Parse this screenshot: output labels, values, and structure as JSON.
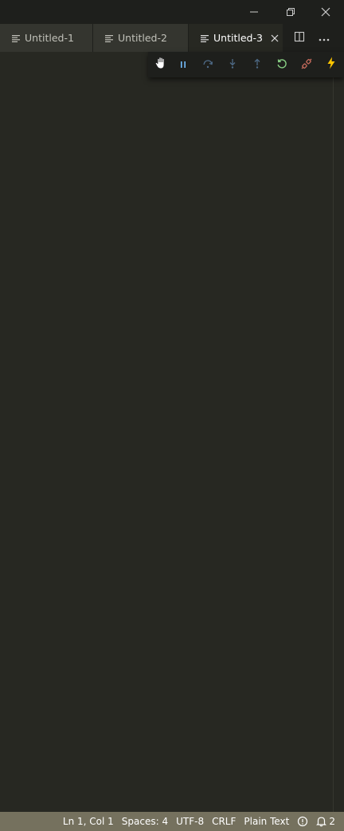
{
  "window": {
    "controls": {
      "minimize_icon": "minimize-icon",
      "restore_icon": "restore-icon",
      "close_icon": "close-icon"
    }
  },
  "tabs": [
    {
      "label": "Untitled-1",
      "icon": "text-file-icon",
      "active": false
    },
    {
      "label": "Untitled-2",
      "icon": "text-file-icon",
      "active": false
    },
    {
      "label": "Untitled-3",
      "icon": "text-file-icon",
      "active": true,
      "closable": true
    }
  ],
  "tab_actions": [
    {
      "icon": "split-editor-icon"
    },
    {
      "icon": "more-actions-icon"
    }
  ],
  "debug_toolbar": {
    "buttons": [
      {
        "icon": "drag-grip-icon",
        "color": "#ffffff"
      },
      {
        "icon": "pause-icon",
        "color": "#75beff"
      },
      {
        "icon": "step-over-icon",
        "color": "#75beff"
      },
      {
        "icon": "step-into-icon",
        "color": "#75beff"
      },
      {
        "icon": "step-out-icon",
        "color": "#75beff"
      },
      {
        "icon": "restart-icon",
        "color": "#89d185"
      },
      {
        "icon": "disconnect-icon",
        "color": "#f48771"
      },
      {
        "icon": "hot-reload-icon",
        "color": "#ffc600"
      }
    ]
  },
  "statusbar": {
    "background": "#75715e",
    "position": "Ln 1, Col 1",
    "indentation": "Spaces: 4",
    "encoding": "UTF-8",
    "eol": "CRLF",
    "language": "Plain Text",
    "feedback_icon": "feedback-icon",
    "notifications_icon": "bell-icon",
    "notifications_count": "2"
  },
  "theme": {
    "editor_background": "#272822",
    "tabbar_background": "#1e1f1c",
    "inactive_tab_background": "#34352f"
  }
}
